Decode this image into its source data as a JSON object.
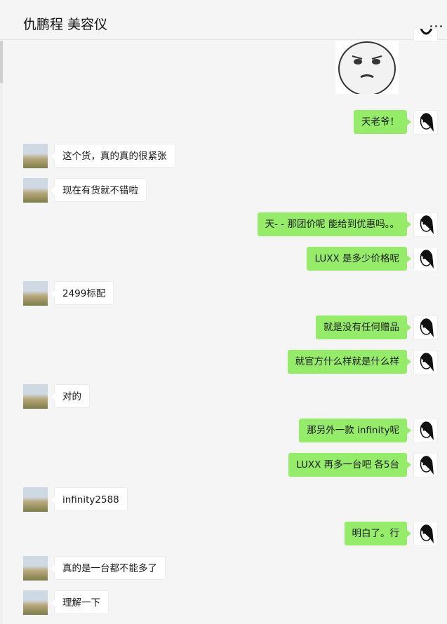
{
  "window": {
    "controls": [
      "minimize",
      "maximize",
      "close"
    ]
  },
  "header": {
    "title": "仇鹏程 美容仪",
    "more_icon": "more-horizontal-icon"
  },
  "messages": [
    {
      "side": "right",
      "text": "天老爷！"
    },
    {
      "side": "left",
      "text": "这个货，真的真的很紧张"
    },
    {
      "side": "left",
      "text": "现在有货就不错啦"
    },
    {
      "side": "right",
      "text": "天- - 那团价呢 能给到优惠吗。。"
    },
    {
      "side": "right",
      "text": "LUXX 是多少价格呢"
    },
    {
      "side": "left",
      "text": "2499标配"
    },
    {
      "side": "right",
      "text": "就是没有任何赠品"
    },
    {
      "side": "right",
      "text": "就官方什么样就是什么样"
    },
    {
      "side": "left",
      "text": "对的"
    },
    {
      "side": "right",
      "text": "那另外一款 infinity呢"
    },
    {
      "side": "right",
      "text": "LUXX 再多一台吧  各5台"
    },
    {
      "side": "left",
      "text": "infinity2588"
    },
    {
      "side": "right",
      "text": "明白了。行"
    },
    {
      "side": "left",
      "text": "真的是一台都不能多了"
    },
    {
      "side": "left",
      "text": "理解一下"
    }
  ],
  "colors": {
    "bubble_self": "#95ec69",
    "bubble_other": "#ffffff",
    "background": "#f5f5f5"
  }
}
